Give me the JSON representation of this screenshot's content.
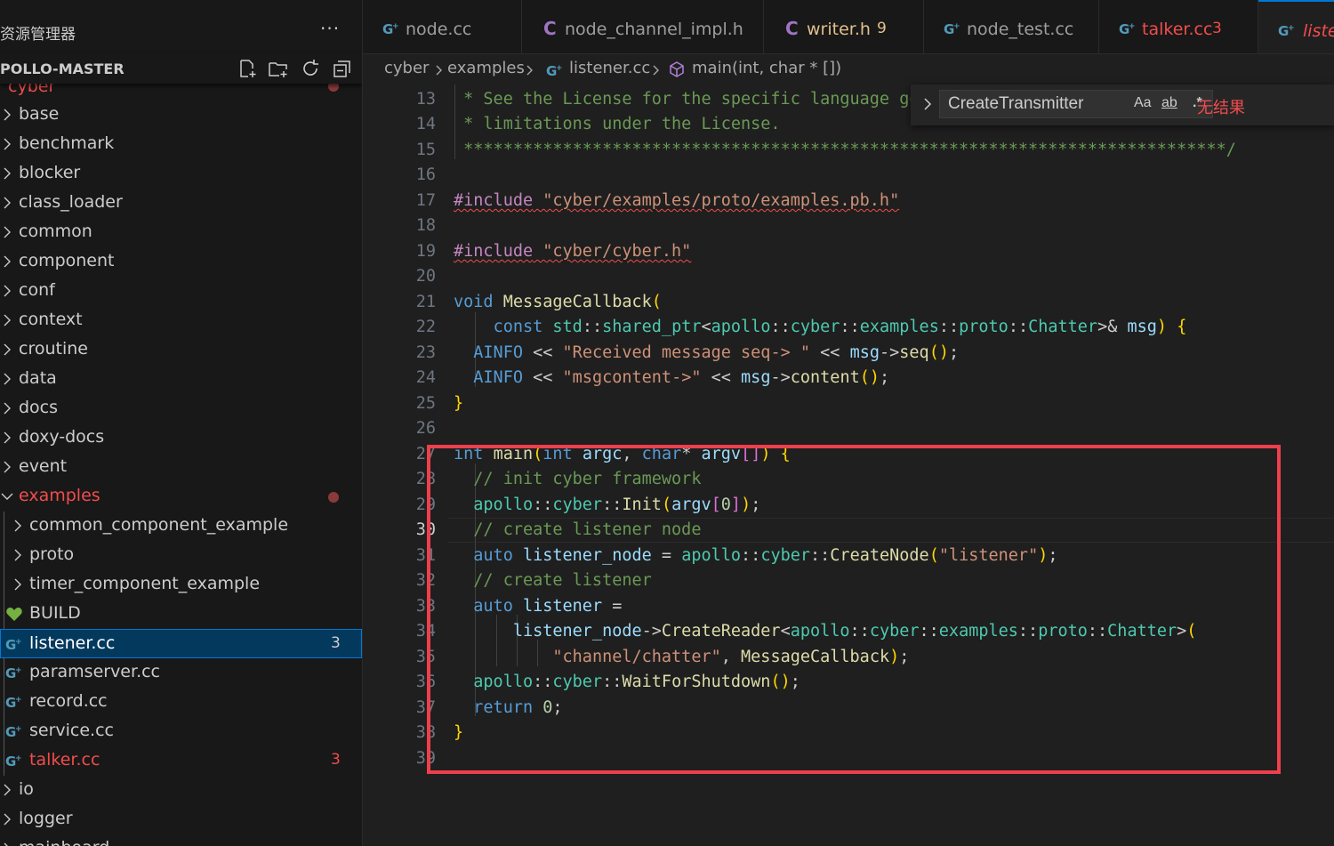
{
  "sidebar": {
    "title": "资源管理器",
    "more": "···",
    "project": "POLLO-MASTER",
    "actions": [
      "new-file-icon",
      "new-folder-icon",
      "refresh-icon",
      "collapse-all-icon"
    ],
    "items": [
      {
        "label": "cyber",
        "kind": "folder-open",
        "status": "modified"
      },
      {
        "label": "base",
        "kind": "folder"
      },
      {
        "label": "benchmark",
        "kind": "folder"
      },
      {
        "label": "blocker",
        "kind": "folder"
      },
      {
        "label": "class_loader",
        "kind": "folder"
      },
      {
        "label": "common",
        "kind": "folder"
      },
      {
        "label": "component",
        "kind": "folder"
      },
      {
        "label": "conf",
        "kind": "folder"
      },
      {
        "label": "context",
        "kind": "folder"
      },
      {
        "label": "croutine",
        "kind": "folder"
      },
      {
        "label": "data",
        "kind": "folder"
      },
      {
        "label": "docs",
        "kind": "folder"
      },
      {
        "label": "doxy-docs",
        "kind": "folder"
      },
      {
        "label": "event",
        "kind": "folder"
      },
      {
        "label": "examples",
        "kind": "folder-open",
        "status": "modified"
      },
      {
        "label": "common_component_example",
        "kind": "folder"
      },
      {
        "label": "proto",
        "kind": "folder"
      },
      {
        "label": "timer_component_example",
        "kind": "folder"
      },
      {
        "label": "BUILD",
        "kind": "file-build"
      },
      {
        "label": "listener.cc",
        "kind": "file-cpp",
        "badge": "3",
        "selected": true
      },
      {
        "label": "paramserver.cc",
        "kind": "file-cpp"
      },
      {
        "label": "record.cc",
        "kind": "file-cpp"
      },
      {
        "label": "service.cc",
        "kind": "file-cpp"
      },
      {
        "label": "talker.cc",
        "kind": "file-cpp",
        "badge": "3",
        "status": "error"
      },
      {
        "label": "io",
        "kind": "folder"
      },
      {
        "label": "logger",
        "kind": "folder"
      },
      {
        "label": "mainboard",
        "kind": "folder"
      }
    ]
  },
  "tabs": [
    {
      "label": "node.cc",
      "icon": "cpp-file-icon"
    },
    {
      "label": "node_channel_impl.h",
      "icon": "c-header-icon"
    },
    {
      "label": "writer.h",
      "icon": "c-header-icon",
      "badge": "9"
    },
    {
      "label": "node_test.cc",
      "icon": "cpp-file-icon"
    },
    {
      "label": "talker.cc",
      "icon": "cpp-file-icon",
      "badge": "3"
    },
    {
      "label": "listener.cc",
      "icon": "cpp-file-icon",
      "active": true
    }
  ],
  "breadcrumb": [
    "cyber",
    "examples",
    "listener.cc",
    "main(int, char * [])"
  ],
  "find": {
    "query": "CreateTransmitter",
    "match_case": "Aa",
    "whole_word": "ab",
    "regex": ".*",
    "result": "无结果"
  },
  "editor": {
    "current_line": "30",
    "lines": [
      {
        "n": "13",
        "text": " * See the License for the specific language governing permissions and"
      },
      {
        "n": "14",
        "text": " * limitations under the License."
      },
      {
        "n": "15",
        "text": " *****************************************************************************/"
      },
      {
        "n": "16",
        "text": ""
      },
      {
        "n": "17",
        "text": "#include \"cyber/examples/proto/examples.pb.h\""
      },
      {
        "n": "18",
        "text": ""
      },
      {
        "n": "19",
        "text": "#include \"cyber/cyber.h\""
      },
      {
        "n": "20",
        "text": ""
      },
      {
        "n": "21",
        "text": "void MessageCallback("
      },
      {
        "n": "22",
        "text": "    const std::shared_ptr<apollo::cyber::examples::proto::Chatter>& msg) {"
      },
      {
        "n": "23",
        "text": "  AINFO << \"Received message seq-> \" << msg->seq();"
      },
      {
        "n": "24",
        "text": "  AINFO << \"msgcontent->\" << msg->content();"
      },
      {
        "n": "25",
        "text": "}"
      },
      {
        "n": "26",
        "text": ""
      },
      {
        "n": "27",
        "text": "int main(int argc, char* argv[]) {"
      },
      {
        "n": "28",
        "text": "  // init cyber framework"
      },
      {
        "n": "29",
        "text": "  apollo::cyber::Init(argv[0]);"
      },
      {
        "n": "30",
        "text": "  // create listener node"
      },
      {
        "n": "31",
        "text": "  auto listener_node = apollo::cyber::CreateNode(\"listener\");"
      },
      {
        "n": "32",
        "text": "  // create listener"
      },
      {
        "n": "33",
        "text": "  auto listener ="
      },
      {
        "n": "34",
        "text": "      listener_node->CreateReader<apollo::cyber::examples::proto::Chatter>("
      },
      {
        "n": "35",
        "text": "          \"channel/chatter\", MessageCallback);"
      },
      {
        "n": "36",
        "text": "  apollo::cyber::WaitForShutdown();"
      },
      {
        "n": "37",
        "text": "  return 0;"
      },
      {
        "n": "38",
        "text": "}"
      },
      {
        "n": "39",
        "text": ""
      }
    ]
  },
  "colors": {
    "accent": "#0078d4",
    "error": "#f14c4c",
    "highlight_box": "#ef3f4c",
    "editor_bg": "#1f1f1f",
    "sidebar_bg": "#181818"
  }
}
